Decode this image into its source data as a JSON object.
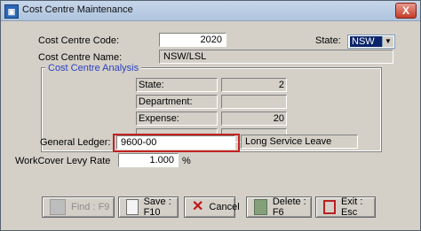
{
  "window": {
    "title": "Cost Centre Maintenance",
    "close_label": "X"
  },
  "form": {
    "cost_centre_code_label": "Cost Centre Code:",
    "cost_centre_code_value": "2020",
    "state_label": "State:",
    "state_value": "NSW",
    "cost_centre_name_label": "Cost Centre Name:",
    "cost_centre_name_value": "NSW/LSL",
    "analysis_title": "Cost Centre Analysis",
    "analysis_rows": [
      {
        "label": "State:",
        "value": "2"
      },
      {
        "label": "Department:",
        "value": ""
      },
      {
        "label": "Expense:",
        "value": "20"
      },
      {
        "label": "",
        "value": ""
      }
    ],
    "general_ledger_label": "General Ledger:",
    "general_ledger_value": "9600-00",
    "general_ledger_desc": "Long Service Leave",
    "workcover_label": "WorkCover Levy Rate",
    "workcover_value": "1.000",
    "workcover_unit": "%"
  },
  "buttons": {
    "find": "Find : F9",
    "save": "Save : F10",
    "cancel": "Cancel",
    "delete": "Delete : F6",
    "exit": "Exit : Esc"
  }
}
